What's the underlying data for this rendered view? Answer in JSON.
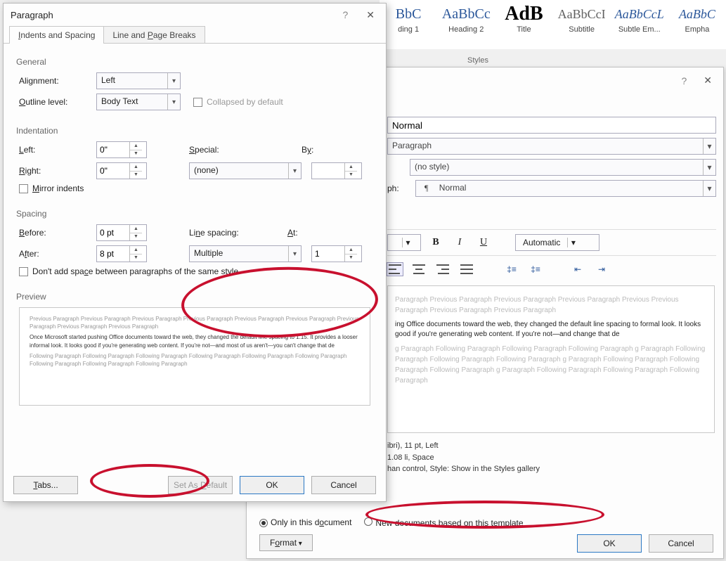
{
  "ribbon": {
    "styles_label": "Styles",
    "cells": [
      {
        "sample": "BbC",
        "label": "ding 1",
        "cls": ""
      },
      {
        "sample": "AaBbCc",
        "label": "Heading 2",
        "cls": ""
      },
      {
        "sample": "AdB",
        "label": "Title",
        "cls": "title"
      },
      {
        "sample": "AaBbCcI",
        "label": "Subtitle",
        "cls": "sub"
      },
      {
        "sample": "AaBbCcL",
        "label": "Subtle Em...",
        "cls": "em"
      },
      {
        "sample": "AaBbC",
        "label": "Empha",
        "cls": "em"
      }
    ]
  },
  "modifyStyle": {
    "name_value": "Normal",
    "type_value": "Paragraph",
    "based_value": "(no style)",
    "following_label": "ph:",
    "following_value": "Normal",
    "font_auto": "Automatic",
    "bold": "B",
    "italic": "I",
    "underline": "U",
    "preview_faint_top": "Paragraph Previous Paragraph Previous Paragraph Previous Paragraph Previous Previous Paragraph Previous Paragraph Previous Paragraph",
    "preview_strong": "ing Office documents toward the web, they changed the default line spacing to formal look. It looks good if you're generating web content. If you're not—and change that de",
    "preview_faint_bot": "g Paragraph Following Paragraph Following Paragraph Following Paragraph g Paragraph Following Paragraph Following Paragraph Following Paragraph g Paragraph Following Paragraph Following Paragraph Following Paragraph g Paragraph Following Paragraph Following Paragraph Following Paragraph",
    "desc_line1": "ibri), 11 pt, Left",
    "desc_line2": "1.08 li, Space",
    "desc_line3": "han control, Style: Show in the Styles gallery",
    "radio_this": "Only in this document",
    "radio_template": "New documents based on this template",
    "format_btn": "Format",
    "ok": "OK",
    "cancel": "Cancel"
  },
  "paragraph": {
    "title": "Paragraph",
    "tab1": "Indents and Spacing",
    "tab2": "Line and Page Breaks",
    "general": "General",
    "alignment_label": "Alignment:",
    "alignment_value": "Left",
    "outline_label": "Outline level:",
    "outline_value": "Body Text",
    "collapsed": "Collapsed by default",
    "indentation": "Indentation",
    "left_label": "Left:",
    "left_val": "0\"",
    "right_label": "Right:",
    "right_val": "0\"",
    "special_label": "Special:",
    "special_value": "(none)",
    "by_label": "By:",
    "by_val": "",
    "mirror": "Mirror indents",
    "spacing": "Spacing",
    "before_label": "Before:",
    "before_val": "0 pt",
    "after_label": "After:",
    "after_val": "8 pt",
    "linespacing_label": "Line spacing:",
    "linespacing_value": "Multiple",
    "at_label": "At:",
    "at_val": "1",
    "dontadd": "Don't add space between paragraphs of the same style",
    "preview_label": "Preview",
    "preview_faint_top": "Previous Paragraph Previous Paragraph Previous Paragraph Previous Paragraph Previous Paragraph Previous Paragraph Previous Paragraph Previous Paragraph Previous Paragraph",
    "preview_mid": "Once Microsoft started pushing Office documents toward the web, they changed the default line spacing to 1.15. It provides a looser informal look. It looks good if you're generating web content. If you're not—and most of us aren't—you can't change that de",
    "preview_faint_bot": "Following Paragraph Following Paragraph Following Paragraph Following Paragraph Following Paragraph Following Paragraph Following Paragraph Following Paragraph Following Paragraph",
    "tabs_btn": "Tabs...",
    "default_btn": "Set As Default",
    "ok": "OK",
    "cancel": "Cancel"
  }
}
